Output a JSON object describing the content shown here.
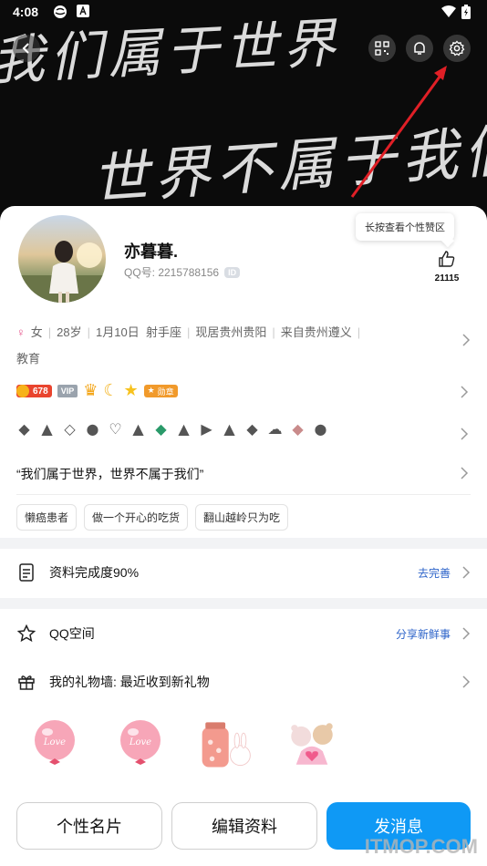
{
  "status_bar": {
    "time": "4:08"
  },
  "cover": {
    "handwriting_line1": "我们属于世界",
    "handwriting_line2": "世界不属于我们"
  },
  "profile": {
    "name": "亦暮暮.",
    "qq_label": "QQ号: 2215788156",
    "id_badge": "ID",
    "like_tooltip": "长按查看个性赞区",
    "like_count": "21115"
  },
  "details": {
    "gender": "女",
    "age": "28岁",
    "birthday": "1月10日",
    "zodiac": "射手座",
    "current_location": "现居贵州贵阳",
    "hometown": "来自贵州遵义",
    "occupation": "教育"
  },
  "badges": {
    "level": "678",
    "vip": "VIP",
    "honor": "勋章"
  },
  "signature": "“我们属于世界，世界不属于我们”",
  "tags": [
    "懒癌患者",
    "做一个开心的吃货",
    "翻山越岭只为吃"
  ],
  "profile_completion": {
    "label": "资料完成度90%",
    "action": "去完善"
  },
  "qzone": {
    "label": "QQ空间",
    "action": "分享新鲜事"
  },
  "gift_wall": {
    "label": "我的礼物墙: 最近收到新礼物",
    "gift_text": "Love"
  },
  "actions": {
    "card_button": "个性名片",
    "edit_button": "编辑资料",
    "message_button": "发消息"
  },
  "watermark": "ITMOP.COM",
  "colors": {
    "accent_blue": "#0f99f5",
    "link_blue": "#2c63c9",
    "annotation_red": "#e01f26"
  }
}
